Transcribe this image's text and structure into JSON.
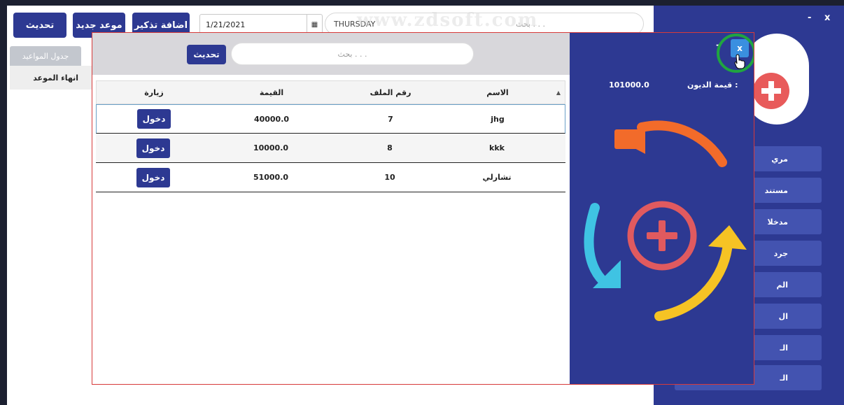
{
  "background_window": {
    "refresh_label": "تحديث",
    "new_appointment_label": "موعد جديد",
    "add_reminder_label": "اضافة تذكير",
    "date_value": "1/21/2021",
    "day_name": "THURSDAY",
    "search_placeholder": "بحث . . .",
    "tab_label": "جدول المواعيد",
    "end_appointment_label": "انهاء الموعد",
    "window_min": "-",
    "window_close": "x",
    "sidebar_items": [
      "مري",
      "مستند",
      "مدخلا",
      "جرد",
      "الم",
      "ال",
      "الـ",
      "الـ"
    ]
  },
  "watermark": "www.zdsoft.com",
  "dialog": {
    "refresh_label": "تحديث",
    "search_placeholder": "بحث . . .",
    "minimize": "-",
    "close": "x",
    "debt_label": "قيمة الديون :",
    "debt_value": "101000.0",
    "table": {
      "headers": {
        "name": "الاسم",
        "file_number": "رقم الملف",
        "value": "القيمة",
        "visit": "زيارة"
      },
      "rows": [
        {
          "name": "jhg",
          "file_number": "7",
          "value": "40000.0",
          "action": "دخول"
        },
        {
          "name": "kkk",
          "file_number": "8",
          "value": "10000.0",
          "action": "دخول"
        },
        {
          "name": "تشارلي",
          "file_number": "10",
          "value": "51000.0",
          "action": "دخول"
        }
      ]
    }
  },
  "colors": {
    "navy": "#2d3992",
    "side_item": "#4353b0",
    "dialog_border": "#d73a3a",
    "close_button": "#3a8fe0",
    "highlight_ring": "#20a540",
    "arrow_orange": "#f26b2a",
    "arrow_cyan": "#3fc3e3",
    "arrow_yellow": "#f6c324",
    "plus_red": "#e05a5f"
  }
}
